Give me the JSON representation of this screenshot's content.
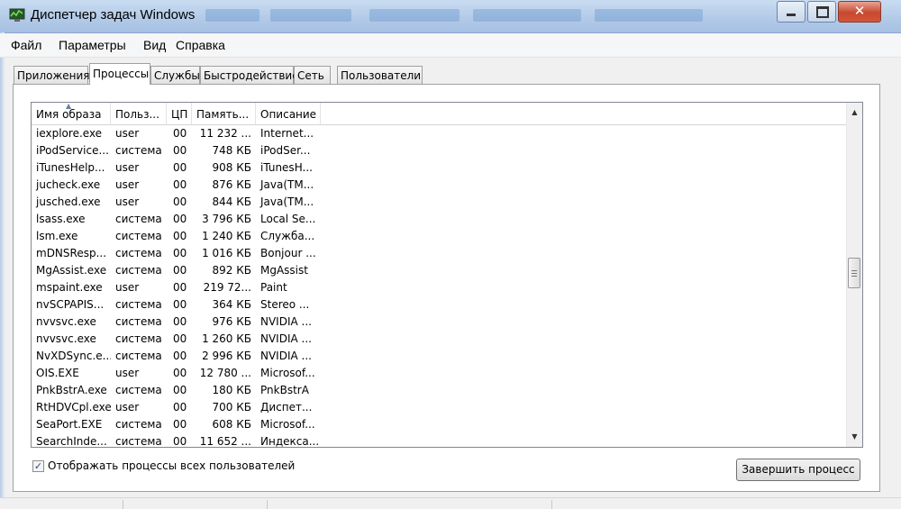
{
  "window": {
    "title": "Диспетчер задач Windows"
  },
  "menu": [
    "Файл",
    "Параметры",
    "Вид",
    "Справка"
  ],
  "tabs": [
    {
      "label": "Приложения",
      "active": false
    },
    {
      "label": "Процессы",
      "active": true
    },
    {
      "label": "Службы",
      "active": false
    },
    {
      "label": "Быстродействие",
      "active": false
    },
    {
      "label": "Сеть",
      "active": false
    },
    {
      "label": "Пользователи",
      "active": false
    }
  ],
  "table": {
    "columns": [
      "Имя образа",
      "Польз...",
      "ЦП",
      "Память...",
      "Описание"
    ],
    "rows": [
      [
        "iexplore.exe",
        "user",
        "00",
        "11 232 ...",
        "Internet..."
      ],
      [
        "iPodService...",
        "система",
        "00",
        "748 КБ",
        "iPodSer..."
      ],
      [
        "iTunesHelp...",
        "user",
        "00",
        "908 КБ",
        "iTunesH..."
      ],
      [
        "jucheck.exe",
        "user",
        "00",
        "876 КБ",
        "Java(TM..."
      ],
      [
        "jusched.exe",
        "user",
        "00",
        "844 КБ",
        "Java(TM..."
      ],
      [
        "lsass.exe",
        "система",
        "00",
        "3 796 КБ",
        "Local Se..."
      ],
      [
        "lsm.exe",
        "система",
        "00",
        "1 240 КБ",
        "Служба..."
      ],
      [
        "mDNSResp...",
        "система",
        "00",
        "1 016 КБ",
        "Bonjour ..."
      ],
      [
        "MgAssist.exe",
        "система",
        "00",
        "892 КБ",
        "MgAssist"
      ],
      [
        "mspaint.exe",
        "user",
        "00",
        "219 72...",
        "Paint"
      ],
      [
        "nvSCPAPIS...",
        "система",
        "00",
        "364 КБ",
        "Stereo ..."
      ],
      [
        "nvvsvc.exe",
        "система",
        "00",
        "976 КБ",
        "NVIDIA ..."
      ],
      [
        "nvvsvc.exe",
        "система",
        "00",
        "1 260 КБ",
        "NVIDIA ..."
      ],
      [
        "NvXDSync.e...",
        "система",
        "00",
        "2 996 КБ",
        "NVIDIA ..."
      ],
      [
        "OIS.EXE",
        "user",
        "00",
        "12 780 ...",
        "Microsof..."
      ],
      [
        "PnkBstrA.exe",
        "система",
        "00",
        "180 КБ",
        "PnkBstrA"
      ],
      [
        "RtHDVCpl.exe",
        "user",
        "00",
        "700 КБ",
        "Диспет..."
      ],
      [
        "SeaPort.EXE",
        "система",
        "00",
        "608 КБ",
        "Microsof..."
      ],
      [
        "SearchInde...",
        "система",
        "00",
        "11 652 ...",
        "Индекса..."
      ]
    ]
  },
  "show_all_users": {
    "label": "Отображать процессы всех пользователей",
    "checked": true
  },
  "end_process_button": "Завершить процесс",
  "colors": {
    "titlebar": "#b9d0ec",
    "close": "#c7482e",
    "panel": "#ffffff"
  }
}
